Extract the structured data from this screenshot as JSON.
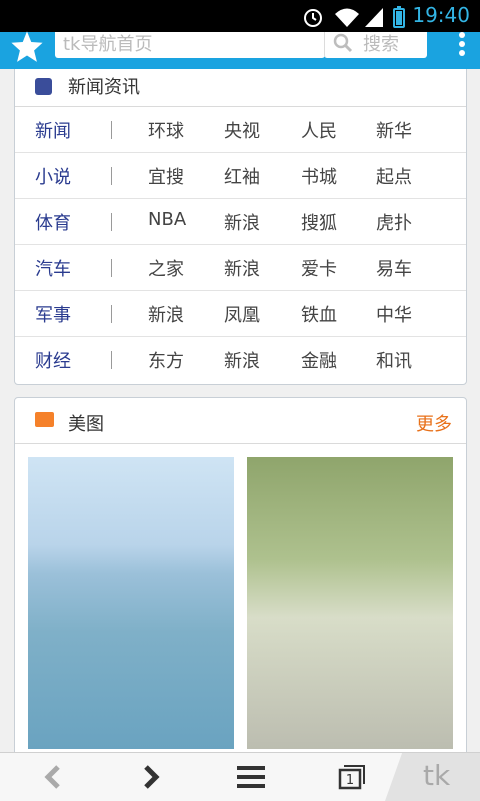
{
  "status_bar": {
    "time": "19:40"
  },
  "toolbar": {
    "url_text": "tk导航首页",
    "search_placeholder": "搜索",
    "accent_color": "#1aa3e0"
  },
  "news": {
    "title": "新闻资讯",
    "rows": [
      {
        "category": "新闻",
        "links": [
          "环球",
          "央视",
          "人民",
          "新华"
        ]
      },
      {
        "category": "小说",
        "links": [
          "宜搜",
          "红袖",
          "书城",
          "起点"
        ]
      },
      {
        "category": "体育",
        "links": [
          "NBA",
          "新浪",
          "搜狐",
          "虎扑"
        ]
      },
      {
        "category": "汽车",
        "links": [
          "之家",
          "新浪",
          "爱卡",
          "易车"
        ]
      },
      {
        "category": "军事",
        "links": [
          "新浪",
          "凤凰",
          "铁血",
          "中华"
        ]
      },
      {
        "category": "财经",
        "links": [
          "东方",
          "新浪",
          "金融",
          "和讯"
        ]
      }
    ]
  },
  "photos": {
    "title": "美图",
    "more_label": "更多",
    "more_color": "#e8711a"
  },
  "bottom_bar": {
    "brand": "tk",
    "tab_count": "1"
  }
}
